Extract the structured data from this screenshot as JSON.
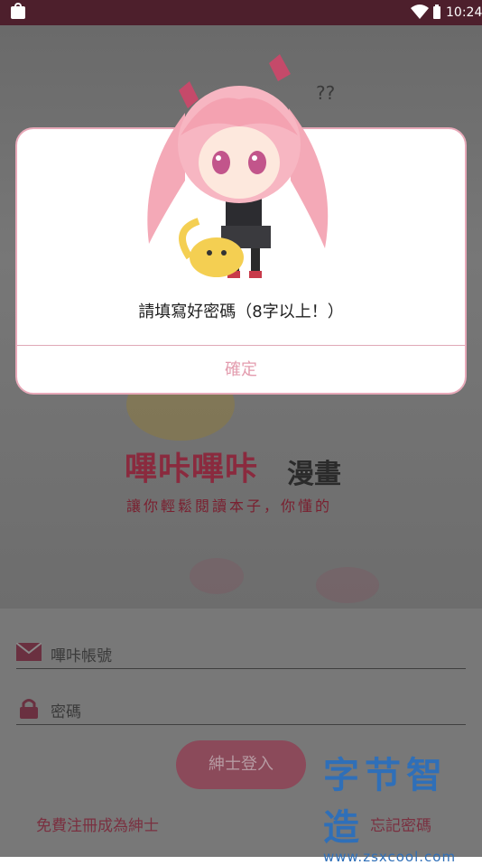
{
  "status_bar": {
    "time": "10:24"
  },
  "background": {
    "logo_title": "嗶咔嗶咔",
    "logo_subtitle": "漫畫",
    "tagline": "讓你輕鬆閱讀本子，你懂的",
    "account_placeholder": "嗶咔帳號",
    "password_placeholder": "密碼",
    "login_button": "紳士登入",
    "register_link": "免費注冊成為紳士",
    "forgot_link": "忘記密碼"
  },
  "dialog": {
    "message": "請填寫好密碼（8字以上！）",
    "confirm_label": "確定"
  },
  "watermark": {
    "title": "字节智造",
    "url": "www.zsxcool.com"
  },
  "colors": {
    "accent": "#e39cae",
    "status_bar": "#4d1f2c",
    "dialog_border": "#e8a9b9"
  },
  "icons": [
    "bag-icon",
    "wifi-icon",
    "battery-icon",
    "mail-icon",
    "lock-icon",
    "mascot-illustration"
  ]
}
